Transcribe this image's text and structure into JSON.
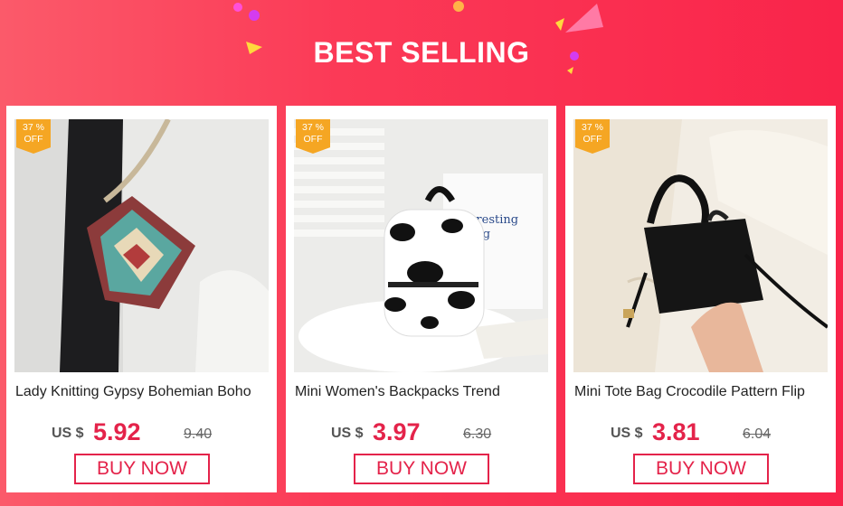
{
  "header": {
    "title": "BEST SELLING"
  },
  "colors": {
    "accent": "#e4234a",
    "badge": "#f5a623"
  },
  "products": [
    {
      "badge_pct": "37 %",
      "badge_off": "OFF",
      "name": "Lady Knitting Gypsy Bohemian Boho",
      "currency": "US $",
      "price": "5.92",
      "old_price": "9.40",
      "button": "BUY NOW"
    },
    {
      "badge_pct": "37 %",
      "badge_off": "OFF",
      "name": "Mini Women's Backpacks Trend",
      "currency": "US $",
      "price": "3.97",
      "old_price": "6.30",
      "button": "BUY NOW",
      "photo_text": "Interesting\nring"
    },
    {
      "badge_pct": "37 %",
      "badge_off": "OFF",
      "name": "Mini Tote Bag  Crocodile Pattern Flip",
      "currency": "US $",
      "price": "3.81",
      "old_price": "6.04",
      "button": "BUY NOW"
    }
  ]
}
